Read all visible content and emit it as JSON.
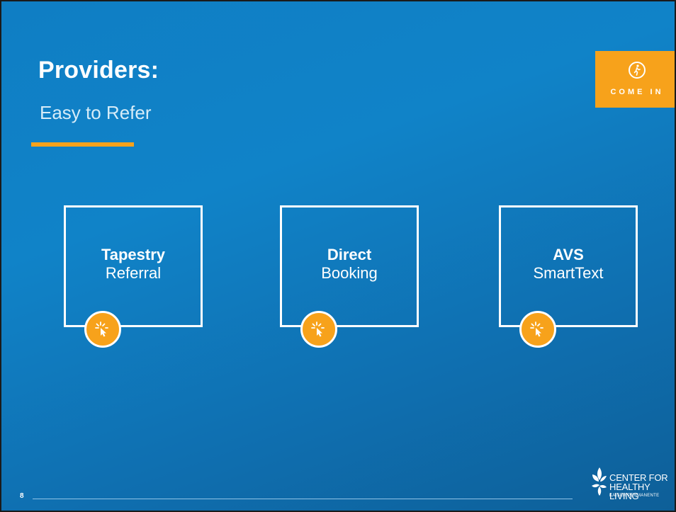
{
  "slide": {
    "title": "Providers:",
    "subtitle": "Easy to Refer",
    "page_number": "8"
  },
  "badge": {
    "icon": "walking-person-icon",
    "label": "COME IN"
  },
  "cards": [
    {
      "strong": "Tapestry",
      "normal": "Referral",
      "icon": "click-cursor-icon"
    },
    {
      "strong": "Direct",
      "normal": "Booking",
      "icon": "click-cursor-icon"
    },
    {
      "strong": "AVS",
      "normal": "SmartText",
      "icon": "click-cursor-icon"
    }
  ],
  "logo": {
    "line1": "CENTER FOR",
    "line2": "HEALTHY LIVING",
    "line3": "KAISER PERMANENTE"
  },
  "colors": {
    "background": "#1083c8",
    "accent": "#f7a21b",
    "text": "#ffffff"
  }
}
